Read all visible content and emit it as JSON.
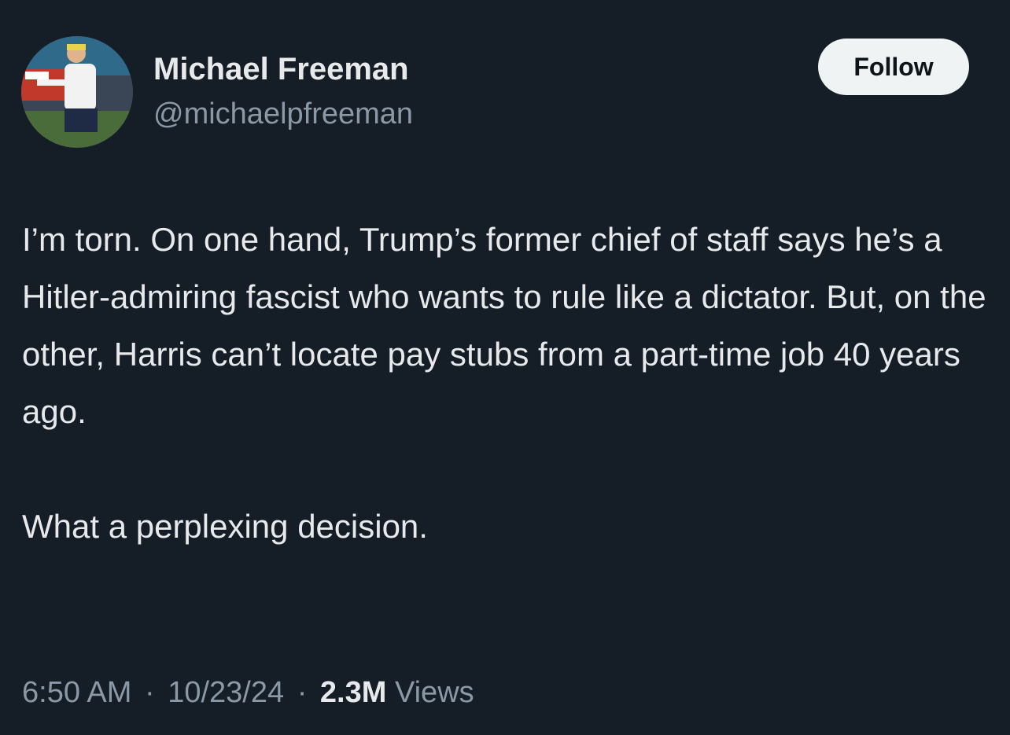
{
  "author": {
    "name": "Michael Freeman",
    "handle": "@michaelpfreeman",
    "avatar_icon": "profile-photo"
  },
  "follow_label": "Follow",
  "tweet": {
    "paragraphs": [
      "I’m torn.  On one hand, Trump’s former chief of staff says he’s a Hitler-admiring fascist who wants to rule like a dictator.  But, on the other, Harris can’t locate pay stubs from a part-time job 40 years ago.",
      "What a perplexing decision."
    ]
  },
  "meta": {
    "time": "6:50 AM",
    "separator": "·",
    "date": "10/23/24",
    "views_count": "2.3M",
    "views_label": "Views"
  },
  "colors": {
    "background": "#151d27",
    "text_primary": "#e7e9ea",
    "text_secondary": "#8b98a5",
    "button_bg": "#eff3f4"
  }
}
